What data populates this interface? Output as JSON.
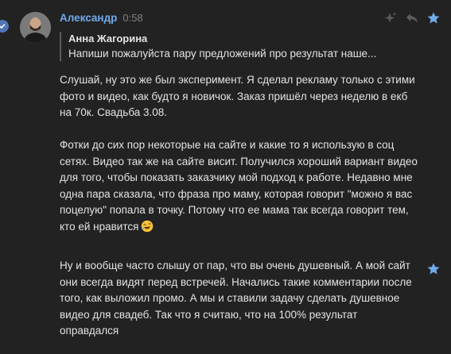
{
  "message": {
    "author": "Александр",
    "time": "0:58",
    "reply": {
      "author": "Анна Жагорина",
      "text": "Напиши пожалуйста пару предложений про результат наше..."
    },
    "paragraphs": [
      "Слушай, ну это же был эксперимент. Я сделал рекламу только с этими фото и видео, как будто я новичок. Заказ пришёл через неделю в екб на 70к. Свадьба 3.08.",
      "Фотки до сих пор некоторые на сайте и какие то я использую в соц сетях. Видео так же на сайте висит. Получился хороший вариант видео для того, чтобы показать заказчику мой подход к работе. Недавно мне одна пара сказала, что фраза про маму, которая говорит \"можно я вас поцелую\" попала в точку. Потому что ее мама так всегда говорит тем, кто ей нравится"
    ]
  },
  "message2": {
    "paragraph": "Ну и вообще часто слышу от пар, что вы очень душевный. А мой сайт они всегда видят перед встречей. Начались такие комментарии после того, как выложил промо. А мы и ставили задачу сделать душевное видео для свадеб. Так что я считаю, что на 100% результат оправдался"
  },
  "icons": {
    "actions": [
      "sparkle-icon",
      "reply-icon",
      "star-icon"
    ],
    "emoji": "laughing-emoji-icon"
  },
  "colors": {
    "background": "#222222",
    "author": "#71aaeb",
    "text": "#e1e3e6",
    "muted": "#828282",
    "star": "#71aaeb"
  }
}
